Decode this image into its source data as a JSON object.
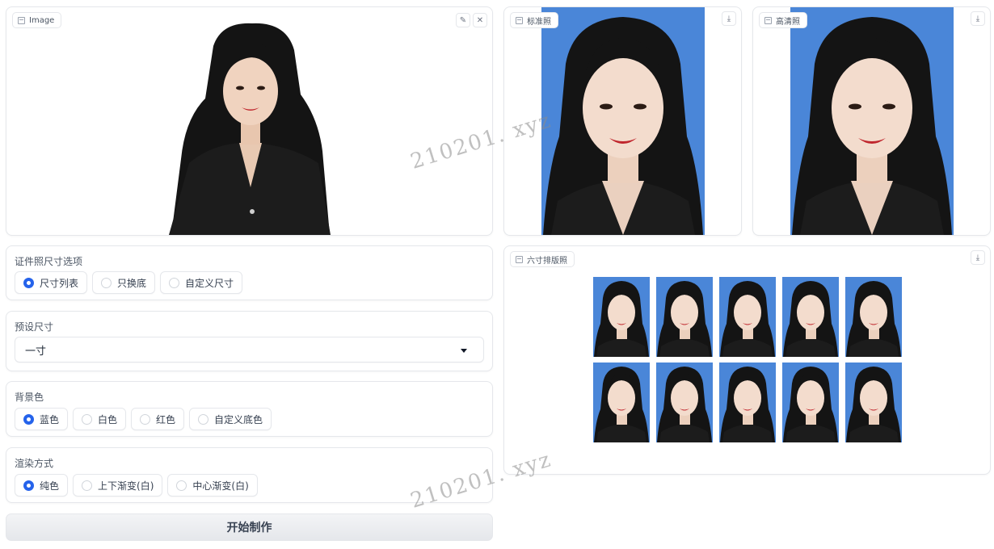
{
  "input_image": {
    "label": "Image"
  },
  "outputs": {
    "standard": {
      "label": "标准照"
    },
    "hd": {
      "label": "高清照"
    },
    "layout": {
      "label": "六寸排版照",
      "thumb_count": 10
    }
  },
  "size_options": {
    "title": "证件照尺寸选项",
    "options": [
      "尺寸列表",
      "只换底",
      "自定义尺寸"
    ],
    "selected": "尺寸列表"
  },
  "preset_size": {
    "title": "预设尺寸",
    "value": "一寸"
  },
  "background_color": {
    "title": "背景色",
    "options": [
      "蓝色",
      "白色",
      "红色",
      "自定义底色"
    ],
    "selected": "蓝色"
  },
  "render_mode": {
    "title": "渲染方式",
    "options": [
      "纯色",
      "上下渐变(白)",
      "中心渐变(白)"
    ],
    "selected": "纯色"
  },
  "start_button": {
    "label": "开始制作"
  },
  "watermark": {
    "text": "210201. xyz"
  },
  "colors": {
    "accent": "#2563eb",
    "photo_bg": "#4a86d8"
  },
  "icons": {
    "edit": "pencil-icon",
    "close": "close-icon",
    "download": "download-icon",
    "image": "image-icon"
  }
}
